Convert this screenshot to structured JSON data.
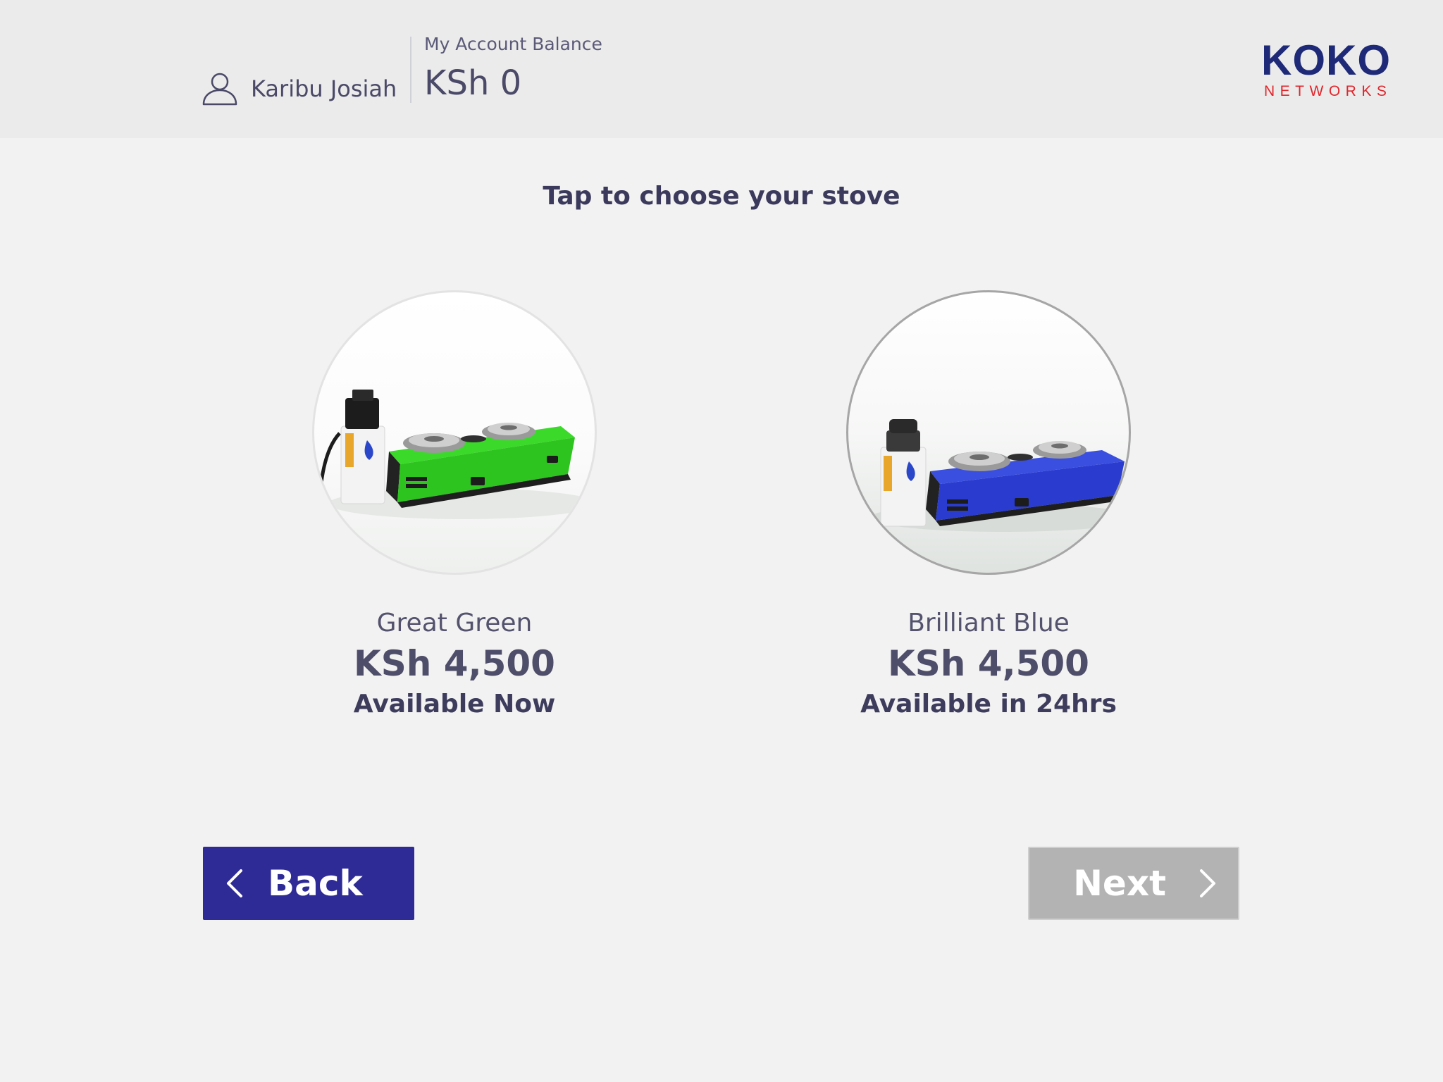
{
  "header": {
    "user_name": "Karibu Josiah",
    "user_icon": "user-icon",
    "balance_label": "My Account Balance",
    "balance_value": "KSh 0",
    "logo_top": "KOKO",
    "logo_bottom": "NETWORKS"
  },
  "prompt": "Tap to choose your stove",
  "stoves": [
    {
      "name": "Great Green",
      "price": "KSh 4,500",
      "availability": "Available Now",
      "color": "#2ec41f"
    },
    {
      "name": "Brilliant Blue",
      "price": "KSh 4,500",
      "availability": "Available in 24hrs",
      "color": "#2a3ccf"
    }
  ],
  "buttons": {
    "back_label": "Back",
    "next_label": "Next"
  },
  "colors": {
    "brand_blue": "#1e2a78",
    "brand_red": "#e0252b",
    "back_button": "#2e2a96",
    "next_button_disabled": "#b3b3b3"
  }
}
